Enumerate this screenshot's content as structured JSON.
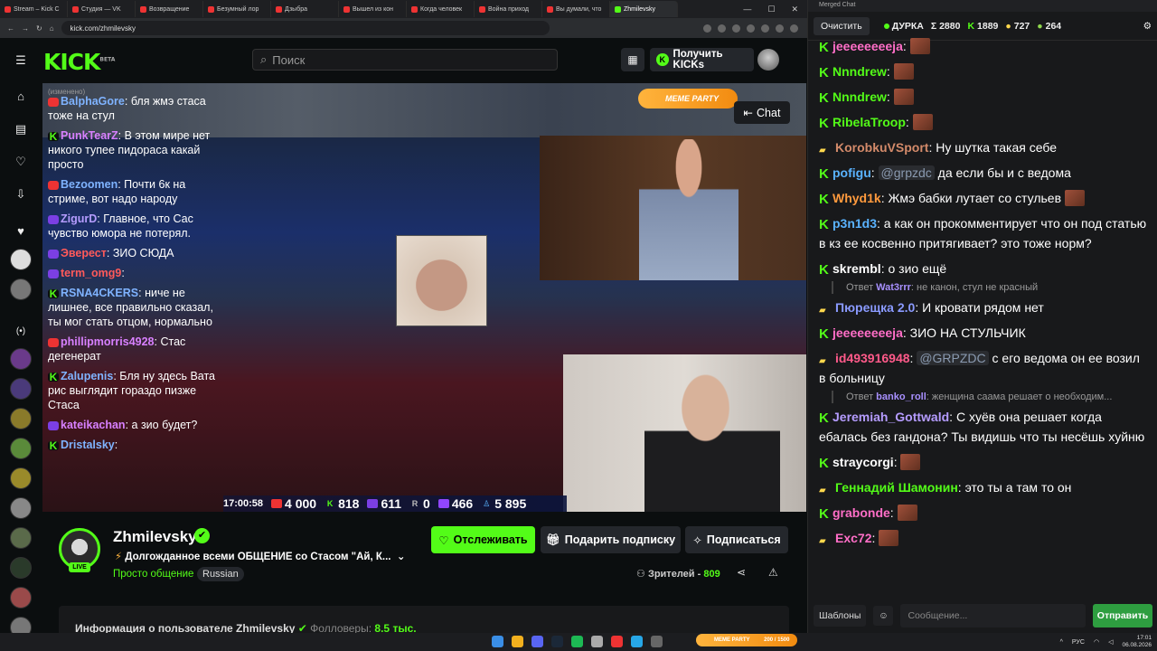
{
  "browser": {
    "tabs": [
      "Stream – Kick C",
      "Студия — VK",
      "Возвращение",
      "Безумный лор",
      "Дзыбра",
      "Вышел из кон",
      "Когда человек",
      "Война приход",
      "Вы думали, что",
      "Zhmilevsky"
    ],
    "url": "kick.com/zhmilevsky"
  },
  "kick": {
    "search_placeholder": "Поиск",
    "get_kicks": "Получить KICKs",
    "chat_button": "Chat",
    "overlay_edited": "(изменено)",
    "meme_party": "MEME PARTY",
    "stream_time": "17:00:58",
    "stats": [
      "4 000",
      "818",
      "611",
      "0",
      "466",
      "5 895"
    ],
    "overlay_chat": [
      {
        "name": "BalphaGore",
        "color": "#7fb3ff",
        "text": "бля жмэ стаса тоже на стул",
        "badge": "yt"
      },
      {
        "name": "PunkTearZ",
        "color": "#d880ff",
        "text": "В этом мире нет никого тупее пидораса какай просто",
        "badge": "k"
      },
      {
        "name": "Bezoomen",
        "color": "#7fb3ff",
        "text": "Почти 6к на стриме, вот надо народу",
        "badge": "yt"
      },
      {
        "name": "ZigurD",
        "color": "#b59cff",
        "text": "Главное, что Сас чувство юмора не потерял.",
        "badge": "lv"
      },
      {
        "name": "Эверест",
        "color": "#ff5a5a",
        "text": "ЗИО СЮДА",
        "badge": "lv"
      },
      {
        "name": "term_omg9",
        "color": "#ff5a5a",
        "text": "",
        "badge": "lv"
      },
      {
        "name": "RSNA4CKERS",
        "color": "#7fb3ff",
        "text": "ниче не лишнее, все правильно сказал, ты мог стать отцом, нормально",
        "badge": "k"
      },
      {
        "name": "phillipmorris4928",
        "color": "#d880ff",
        "text": "Стас дегенерат",
        "badge": "yt"
      },
      {
        "name": "Zalupenis",
        "color": "#7fb3ff",
        "text": "Бля ну здесь Вата рис выглядит гораздо пизже Стаса",
        "badge": "k"
      },
      {
        "name": "kateikachan",
        "color": "#d880ff",
        "text": "а зио будет?",
        "badge": "lv"
      },
      {
        "name": "Dristalsky",
        "color": "#7fb3ff",
        "text": "",
        "badge": "k"
      }
    ],
    "channel": {
      "name": "Zhmilevsky",
      "live": "LIVE",
      "title": "Долгожданное всеми ОБЩЕНИЕ со Стасом \"Ай, К...",
      "category": "Просто общение",
      "tag": "Russian",
      "follow": "Отслеживать",
      "gift": "Подарить подписку",
      "subscribe": "Подписаться",
      "viewers_label": "Зрителей -",
      "viewers": "809",
      "about": "Информация о пользователе Zhmilevsky",
      "followers_label": "Фолловеры:",
      "followers": "8.5 тыс."
    }
  },
  "merged": {
    "window_title": "Merged Chat",
    "clear": "Очистить",
    "status": "ДУРКА",
    "sigma": "Σ 2880",
    "count_k": "1889",
    "count_a": "727",
    "count_b": "264",
    "templates": "Шаблоны",
    "input_placeholder": "Сообщение...",
    "send": "Отправить",
    "messages": [
      {
        "badge": "k",
        "name": "jeeeeeeeeja",
        "color": "#ff6ec7",
        "text": "",
        "emote": true
      },
      {
        "badge": "k",
        "name": "Nnndrew",
        "color": "#53fc18",
        "text": "",
        "emote": true
      },
      {
        "badge": "k",
        "name": "Nnndrew",
        "color": "#53fc18",
        "text": "",
        "emote": true
      },
      {
        "badge": "k",
        "name": "RibelaTroop",
        "color": "#53fc18",
        "text": "",
        "emote": true
      },
      {
        "badge": "t",
        "name": "KorobkuVSport",
        "color": "#d38a6a",
        "text": "Ну шутка такая себе",
        "emote": false
      },
      {
        "badge": "k",
        "name": "pofigu",
        "color": "#5ab3ff",
        "mention": "@grpzdc",
        "text": "да если бы и с ведома",
        "emote": false
      },
      {
        "badge": "k",
        "name": "Whyd1k",
        "color": "#ff9a3d",
        "text": "Жмэ бабки лутает со стульев",
        "emote": true
      },
      {
        "badge": "k",
        "name": "p3n1d3",
        "color": "#5ab3ff",
        "text": "а как он прокомментирует что он под статью в кз ее косвенно притягивает? это тоже норм?",
        "emote": false
      },
      {
        "badge": "k",
        "name": "skrembl",
        "color": "#ffffff",
        "text": "о зио ещё",
        "emote": false
      },
      {
        "badge": "t",
        "name": "Пюрещка 2.0",
        "color": "#8a9aff",
        "text": "И кровати рядом нет",
        "emote": false,
        "reply_to": "Wat3rrr",
        "reply_text": "не канон, стул не красный"
      },
      {
        "badge": "k",
        "name": "jeeeeeeeeja",
        "color": "#ff6ec7",
        "text": "ЗИО НА СТУЛЬЧИК",
        "emote": false
      },
      {
        "badge": "t",
        "name": "id493916948",
        "color": "#ff5a8a",
        "mention": "@GRPZDC",
        "text": "с его ведома он ее возил в больницу",
        "emote": false
      },
      {
        "badge": "k",
        "name": "Jeremiah_Gottwald",
        "color": "#b59cff",
        "text": "С хуёв она решает когда ебалась без гандона? Ты видишь что ты несёшь хуйню",
        "emote": false,
        "reply_to": "banko_roll",
        "reply_text": "женщина саама решает о необходим..."
      },
      {
        "badge": "k",
        "name": "straycorgi",
        "color": "#ffffff",
        "text": "",
        "emote": true
      },
      {
        "badge": "t",
        "name": "Геннадий Шамонин",
        "color": "#53fc18",
        "text": "это ты а там то он",
        "emote": false
      },
      {
        "badge": "k",
        "name": "grabonde",
        "color": "#ff6ec7",
        "text": "",
        "emote": true
      },
      {
        "badge": "t",
        "name": "Exc72",
        "color": "#ff6ec7",
        "text": "",
        "emote": true
      }
    ]
  },
  "taskbar": {
    "lang": "РУС",
    "time": "17:01",
    "date": "06.08.2026",
    "meme": "MEME PARTY",
    "meme_progress": "200 / 1500"
  }
}
